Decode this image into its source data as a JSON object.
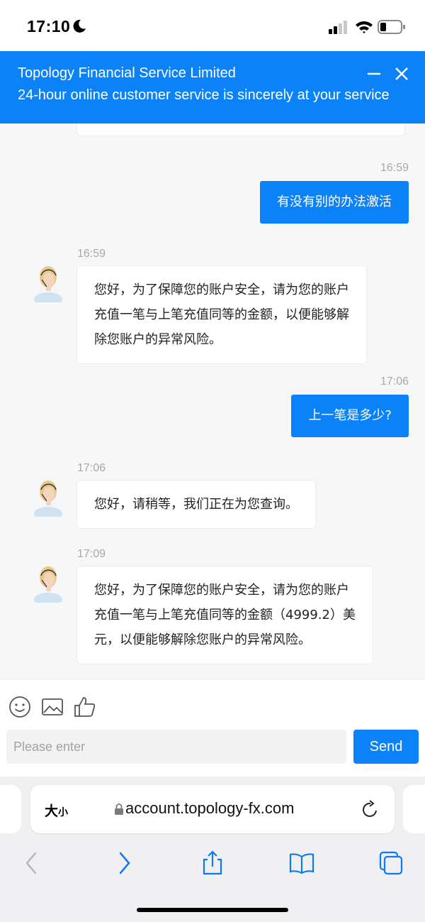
{
  "status_bar": {
    "time": "17:10"
  },
  "header": {
    "title": "Topology Financial Service Limited",
    "subtitle": "24-hour online customer service is sincerely at your service"
  },
  "messages": [
    {
      "side": "out",
      "time": "16:59",
      "text": "有没有别的办法激活"
    },
    {
      "side": "in",
      "time": "16:59",
      "lines": [
        "您好，为了保障您的账户安全，请为您的账户",
        "充值一笔与上笔充值同等的金额，以便能够解",
        "除您账户的异常风险。"
      ]
    },
    {
      "side": "out",
      "time": "17:06",
      "text": "上一笔是多少?"
    },
    {
      "side": "in",
      "time": "17:06",
      "lines": [
        "您好，请稍等，我们正在为您查询。"
      ]
    },
    {
      "side": "in",
      "time": "17:09",
      "lines": [
        "您好，为了保障您的账户安全，请为您的账户",
        "充值一笔与上笔充值同等的金额（4999.2）美",
        "元，以便能够解除您账户的异常风险。"
      ]
    }
  ],
  "composer": {
    "placeholder": "Please enter",
    "send_label": "Send"
  },
  "browser": {
    "reader_big": "大",
    "reader_small": "小",
    "url": "account.topology-fx.com"
  },
  "colors": {
    "accent": "#0b82f7",
    "background": "#f7f7f7"
  }
}
